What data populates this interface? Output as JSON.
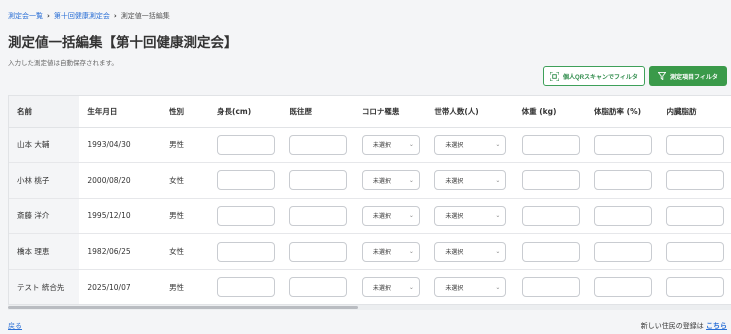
{
  "breadcrumb": {
    "items": [
      "測定会一覧",
      "第十回健康測定会"
    ],
    "separator": "›",
    "current": "測定値一括編集"
  },
  "page_title": "測定値一括編集【第十回健康測定会】",
  "autosave_note": "入力した測定値は自動保存されます。",
  "buttons": {
    "qr_filter": "個人QRスキャンでフィルタ",
    "item_filter": "測定項目フィルタ"
  },
  "table": {
    "headers": [
      "名前",
      "生年月日",
      "性別",
      "身長(cm)",
      "既往歴",
      "コロナ罹患",
      "世帯人数(人)",
      "体重 (kg)",
      "体脂肪率 (%)",
      "内臓脂肪"
    ],
    "select_placeholder": "未選択",
    "rows": [
      {
        "name": "山本 大輔",
        "birth": "1993/04/30",
        "gender": "男性"
      },
      {
        "name": "小林 桃子",
        "birth": "2000/08/20",
        "gender": "女性"
      },
      {
        "name": "斎藤 洋介",
        "birth": "1995/12/10",
        "gender": "男性"
      },
      {
        "name": "橋本 理恵",
        "birth": "1982/06/25",
        "gender": "女性"
      },
      {
        "name": "テスト 統合先",
        "birth": "2025/10/07",
        "gender": "男性"
      }
    ]
  },
  "footer": {
    "back_label": "戻る",
    "register_prefix": "新しい住民の登録は",
    "register_link": "こちら"
  },
  "colors": {
    "accent_green": "#3a9a4a",
    "link_blue": "#2a6fd6"
  },
  "icons": {
    "qr": "qr-scan-icon",
    "filter": "filter-icon",
    "chevron": "chevron-down-icon"
  }
}
